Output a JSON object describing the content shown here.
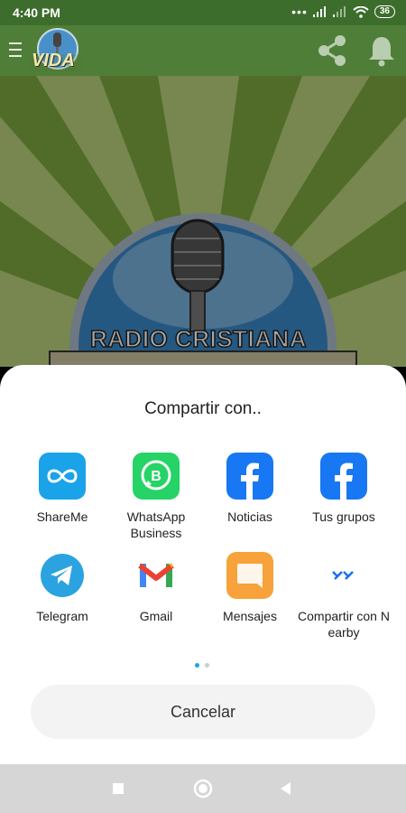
{
  "status": {
    "time": "4:40 PM",
    "battery": "36"
  },
  "appbar": {
    "logo_text": "VIDA"
  },
  "hero": {
    "logo_text": "RADIO CRISTIANA"
  },
  "sheet": {
    "title": "Compartir con..",
    "apps": [
      {
        "label": "ShareMe",
        "icon": "shareme-icon",
        "color": "#1aa3e8"
      },
      {
        "label": "WhatsApp Business",
        "icon": "whatsapp-business-icon",
        "color": "#25d366"
      },
      {
        "label": "Noticias",
        "icon": "facebook-icon",
        "color": "#1877f2"
      },
      {
        "label": "Tus grupos",
        "icon": "facebook-icon",
        "color": "#1877f2"
      },
      {
        "label": "Telegram",
        "icon": "telegram-icon",
        "color": "#2aa3e0"
      },
      {
        "label": "Gmail",
        "icon": "gmail-icon",
        "color": "#ea4335"
      },
      {
        "label": "Mensajes",
        "icon": "messages-icon",
        "color": "#f7a23b"
      },
      {
        "label": "Compartir con Nearby",
        "icon": "nearby-share-icon",
        "color": "#1a73e8"
      }
    ],
    "page_indicator": {
      "current": 1,
      "total": 2
    },
    "cancel_label": "Cancelar"
  }
}
